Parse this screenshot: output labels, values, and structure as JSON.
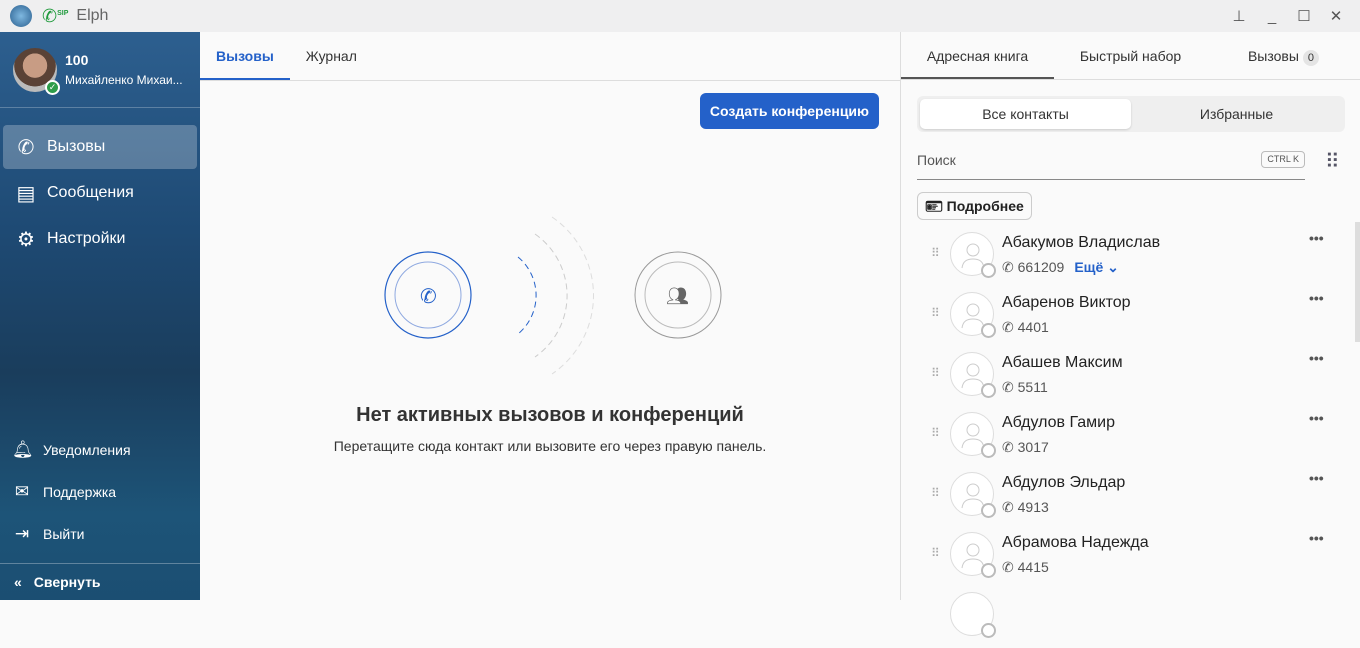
{
  "app": {
    "title": "Elph",
    "sip_label": "SIP"
  },
  "user": {
    "number": "100",
    "name": "Михайленко Михаи..."
  },
  "sidebar": {
    "items": [
      {
        "label": "Вызовы",
        "icon": "phone-icon"
      },
      {
        "label": "Сообщения",
        "icon": "message-icon"
      },
      {
        "label": "Настройки",
        "icon": "gear-icon"
      }
    ],
    "bottom": [
      {
        "label": "Уведомления",
        "icon": "bell-icon"
      },
      {
        "label": "Поддержка",
        "icon": "mail-icon"
      },
      {
        "label": "Выйти",
        "icon": "logout-icon"
      }
    ],
    "collapse": "Свернуть"
  },
  "main": {
    "tabs": [
      "Вызовы",
      "Журнал"
    ],
    "create_conference": "Создать конференцию",
    "empty_title": "Нет активных вызовов и конференций",
    "empty_sub": "Перетащите сюда контакт или вызовите его через правую панель."
  },
  "right": {
    "tabs": [
      "Адресная книга",
      "Быстрый набор",
      "Вызовы"
    ],
    "calls_count": "0",
    "segments": [
      "Все контакты",
      "Избранные"
    ],
    "search_placeholder": "Поиск",
    "shortcut": "CTRL K",
    "details": "Подробнее",
    "more_label": "Ещё",
    "contacts": [
      {
        "name": "Абакумов Владислав",
        "number": "661209"
      },
      {
        "name": "Абаренов Виктор",
        "number": "4401"
      },
      {
        "name": "Абашев Максим",
        "number": "5511"
      },
      {
        "name": "Абдулов Гамир",
        "number": "3017"
      },
      {
        "name": "Абдулов Эльдар",
        "number": "4913"
      },
      {
        "name": "Абрамова Надежда",
        "number": "4415"
      }
    ]
  },
  "colors": {
    "accent": "#2461c9",
    "sidebar": "#1e4a74"
  }
}
